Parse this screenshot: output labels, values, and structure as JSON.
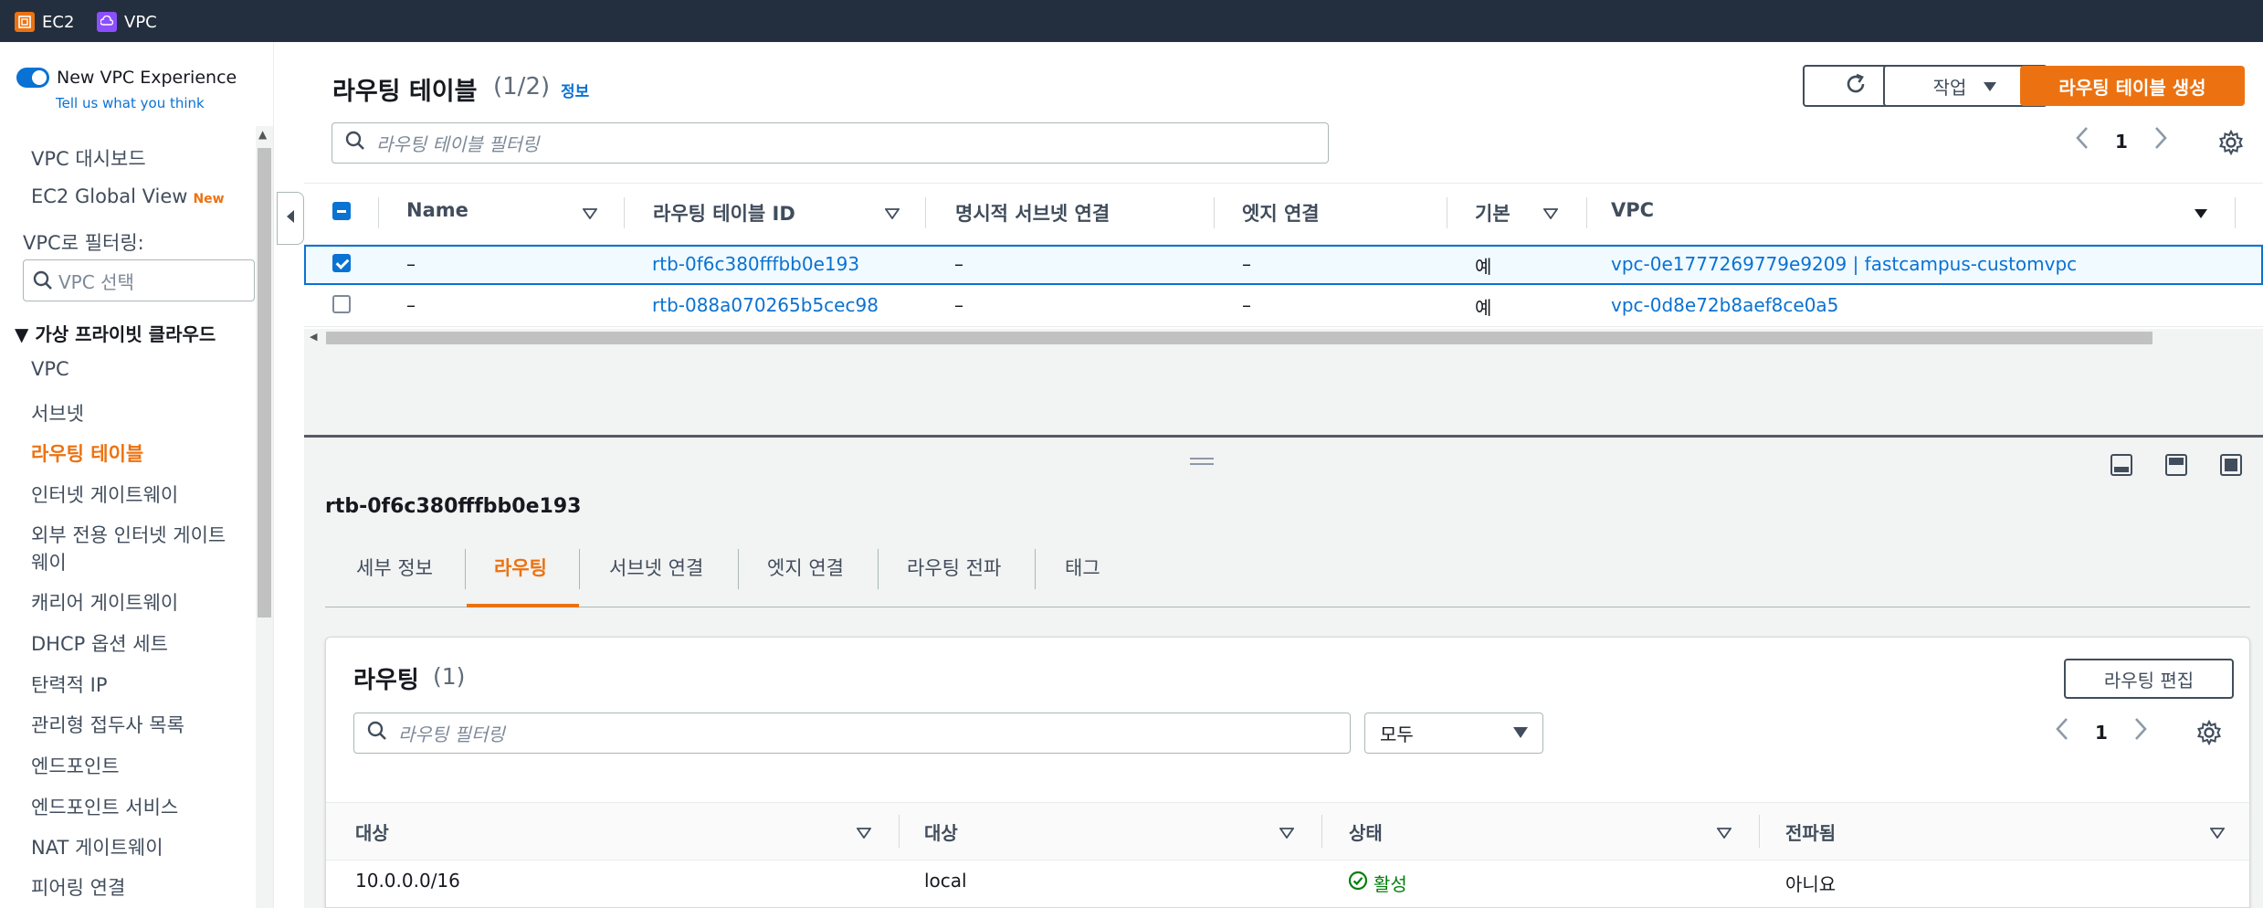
{
  "topbar": {
    "services": [
      {
        "label": "EC2",
        "icon": "ec2-icon",
        "color": "#ec7211"
      },
      {
        "label": "VPC",
        "icon": "vpc-icon",
        "color": "#8c4fff"
      }
    ]
  },
  "sidebar": {
    "toggle_label": "New VPC Experience",
    "feedback_link": "Tell us what you think",
    "dashboard": "VPC 대시보드",
    "global_view": "EC2 Global View",
    "new_badge": "New",
    "filter_label": "VPC로 필터링:",
    "vpc_select_placeholder": "VPC 선택",
    "section_title": "가상 프라이빗 클라우드",
    "items": [
      "VPC",
      "서브넷",
      "라우팅 테이블",
      "인터넷 게이트웨이",
      "외부 전용 인터넷 게이트",
      "웨이",
      "캐리어 게이트웨이",
      "DHCP 옵션 세트",
      "탄력적 IP",
      "관리형 접두사 목록",
      "엔드포인트",
      "엔드포인트 서비스",
      "NAT 게이트웨이",
      "피어링 연결"
    ],
    "active_index": 2
  },
  "header": {
    "title": "라우팅 테이블",
    "count": "(1/2)",
    "info": "정보",
    "actions_label": "작업",
    "create_label": "라우팅 테이블 생성",
    "search_placeholder": "라우팅 테이블 필터링",
    "page": "1"
  },
  "table": {
    "columns": [
      "Name",
      "라우팅 테이블 ID",
      "명시적 서브넷 연결",
      "엣지 연결",
      "기본",
      "VPC"
    ],
    "rows": [
      {
        "name": "–",
        "id": "rtb-0f6c380fffbb0e193",
        "subnet": "–",
        "edge": "–",
        "main": "예",
        "vpc": "vpc-0e1777269779e9209 | fastcampus-customvpc",
        "selected": true
      },
      {
        "name": "–",
        "id": "rtb-088a070265b5cec98",
        "subnet": "–",
        "edge": "–",
        "main": "예",
        "vpc": "vpc-0d8e72b8aef8ce0a5",
        "selected": false
      }
    ]
  },
  "detail": {
    "title": "rtb-0f6c380fffbb0e193",
    "tabs": [
      "세부 정보",
      "라우팅",
      "서브넷 연결",
      "엣지 연결",
      "라우팅 전파",
      "태그"
    ],
    "active_tab": 1
  },
  "routes": {
    "title": "라우팅",
    "count": "(1)",
    "edit_label": "라우팅 편집",
    "search_placeholder": "라우팅 필터링",
    "filter_value": "모두",
    "page": "1",
    "columns": [
      "대상",
      "대상",
      "상태",
      "전파됨"
    ],
    "rows": [
      {
        "destination": "10.0.0.0/16",
        "target": "local",
        "status": "활성",
        "propagated": "아니요"
      }
    ]
  },
  "colors": {
    "accent": "#ec7211",
    "link": "#0972d3",
    "active_status": "#037f0c",
    "topbar": "#232f3e"
  }
}
